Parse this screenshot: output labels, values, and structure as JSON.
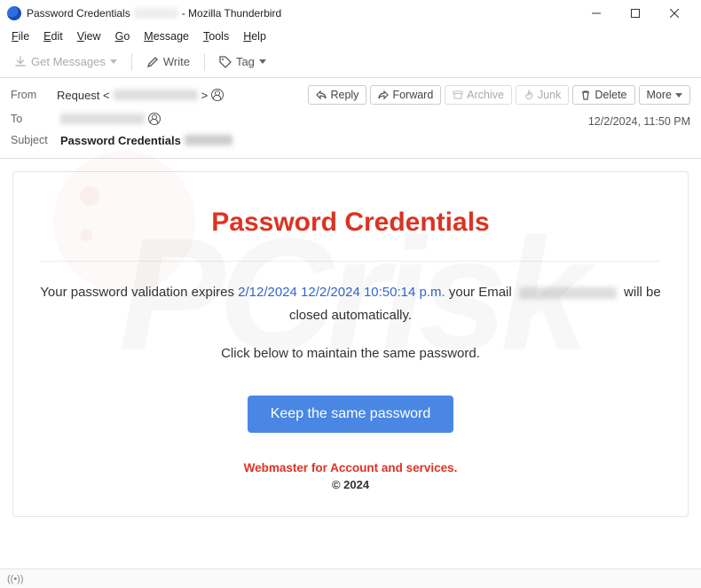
{
  "window": {
    "title_prefix": "Password Credentials",
    "title_suffix": " - Mozilla Thunderbird"
  },
  "menu": {
    "file": "File",
    "edit": "Edit",
    "view": "View",
    "go": "Go",
    "message": "Message",
    "tools": "Tools",
    "help": "Help"
  },
  "toolbar": {
    "get_messages": "Get Messages",
    "write": "Write",
    "tag": "Tag"
  },
  "actions": {
    "reply": "Reply",
    "forward": "Forward",
    "archive": "Archive",
    "junk": "Junk",
    "delete": "Delete",
    "more": "More"
  },
  "headers": {
    "from_label": "From",
    "from_value": "Request <",
    "from_suffix": ">",
    "to_label": "To",
    "subject_label": "Subject",
    "subject_value": "Password Credentials",
    "date": "12/2/2024, 11:50 PM"
  },
  "body": {
    "title": "Password Credentials",
    "line1a": "Your password validation expires ",
    "line1_date": "2/12/2024 12/2/2024 10:50:14 p.m.",
    "line1b": " your Email ",
    "line1c": " will be closed automatically.",
    "line2": "Click below to maintain the same password.",
    "button": "Keep the same password",
    "foot_a": "Webmaster for ",
    "foot_b": " Account and services.",
    "copyright": "© 2024"
  },
  "status": {
    "icon": "((•))"
  }
}
